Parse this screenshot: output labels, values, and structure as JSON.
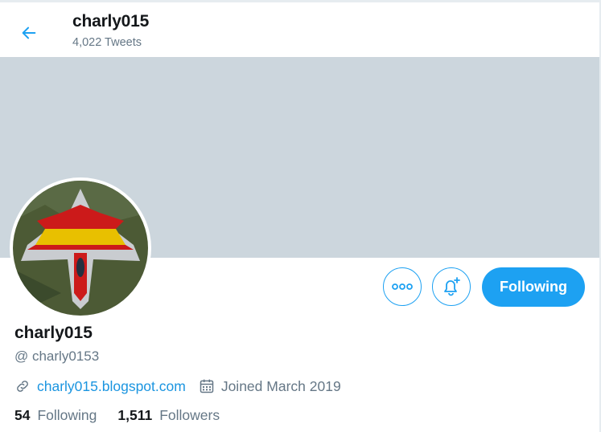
{
  "header": {
    "name": "charly015",
    "tweet_count": "4,022 Tweets"
  },
  "profile": {
    "display_name": "charly015",
    "handle": "@ charly0153",
    "website": "charly015.blogspot.com",
    "joined": "Joined March 2019"
  },
  "actions": {
    "more_label": "More",
    "notify_label": "Notifications",
    "follow_label": "Following"
  },
  "stats": {
    "following_count": "54",
    "following_label": "Following",
    "followers_count": "1,511",
    "followers_label": "Followers"
  },
  "colors": {
    "accent": "#1da1f2",
    "banner": "#ccd6dd",
    "muted": "#657786",
    "link": "#1b95e0"
  },
  "icons": [
    "back-arrow-icon",
    "more-dots-icon",
    "bell-plus-icon",
    "link-icon",
    "calendar-icon"
  ]
}
